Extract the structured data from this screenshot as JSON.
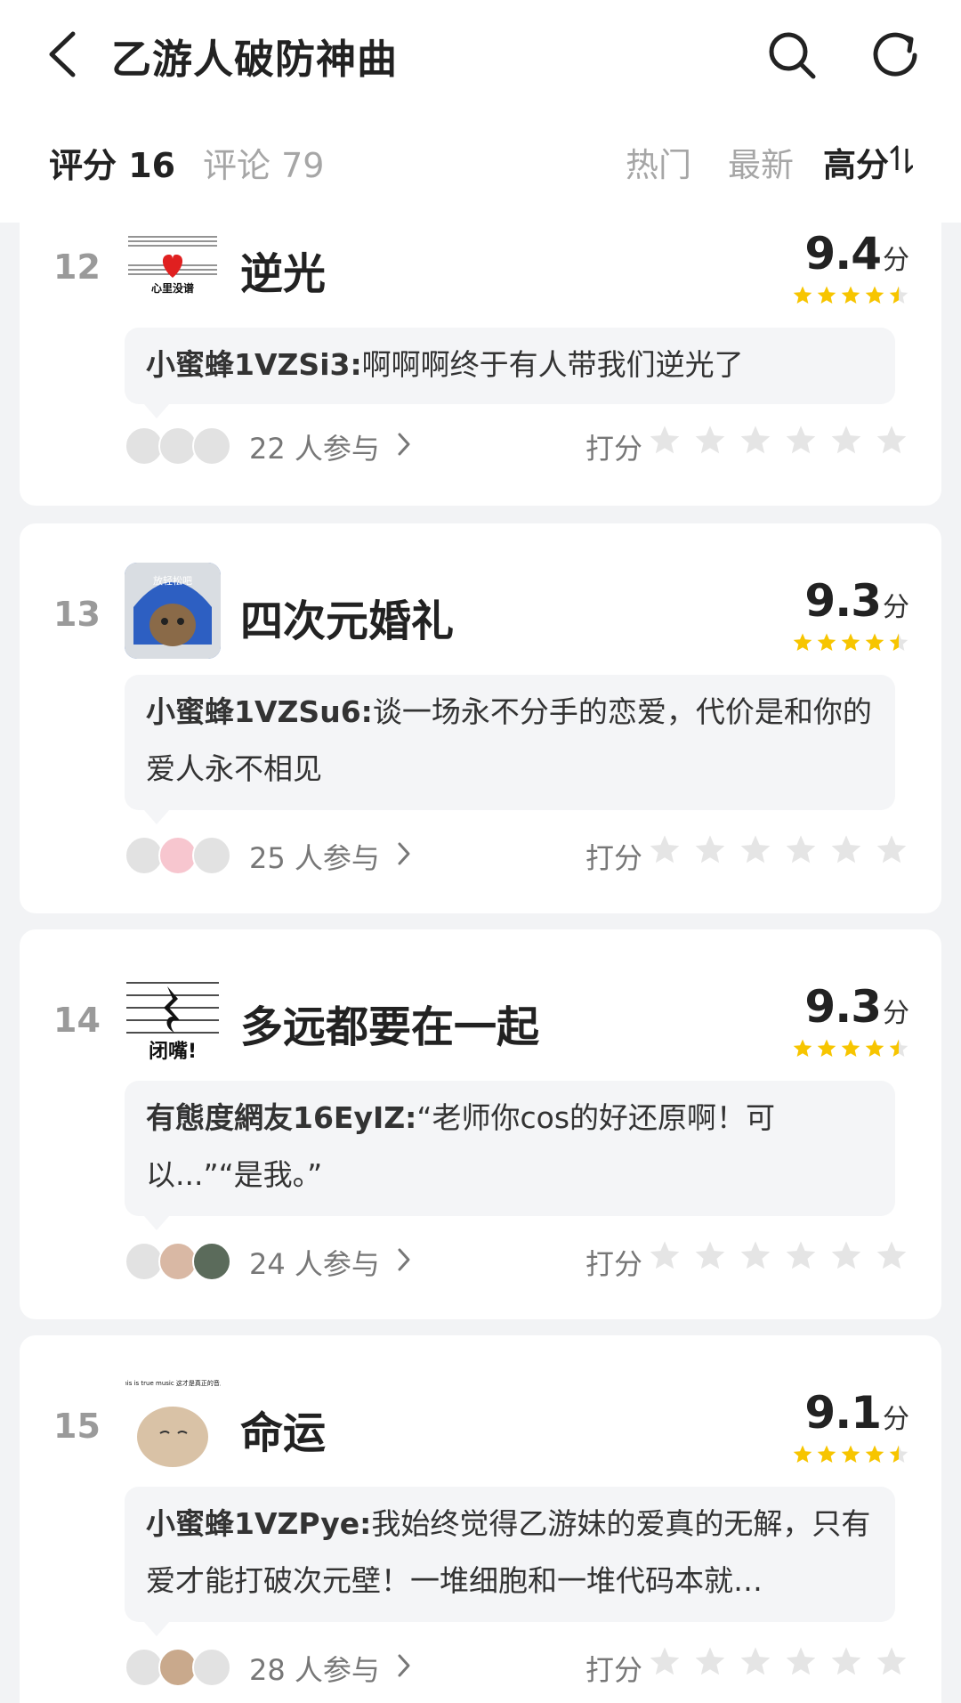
{
  "header": {
    "title": "乙游人破防神曲",
    "back_icon": "chevron-left-icon",
    "search_icon": "search-icon",
    "refresh_icon": "refresh-icon"
  },
  "tabs": {
    "score": "评分 16",
    "comments": "评论 79"
  },
  "sort": {
    "hot": "热门",
    "latest": "最新",
    "high": "高分",
    "high_icon": "sort-arrows-icon"
  },
  "colors": {
    "star_yellow": "#f7c500",
    "star_gray": "#e5e5e5",
    "background": "#f2f3f5"
  },
  "unit": "分",
  "rate_label": "打分",
  "items": [
    {
      "rank": "12",
      "title": "逆光",
      "score": "9.4",
      "rating": 4.5,
      "cover_text": "心里没谱",
      "comment_user": "小蜜蜂1VZSi3:",
      "comment_text": "啊啊啊终于有人带我们逆光了",
      "participants": "22 人参与"
    },
    {
      "rank": "13",
      "title": "四次元婚礼",
      "score": "9.3",
      "rating": 4.5,
      "cover_text": "放轻松吧",
      "comment_user": "小蜜蜂1VZSu6:",
      "comment_text": "谈一场永不分手的恋爱，代价是和你的爱人永不相见",
      "participants": "25 人参与"
    },
    {
      "rank": "14",
      "title": "多远都要在一起",
      "score": "9.3",
      "rating": 4.5,
      "cover_text": "闭嘴!",
      "comment_user": "有態度網友16EyIZ:",
      "comment_text": "“老师你cos的好还原啊！可以...”“是我。”",
      "participants": "24 人参与"
    },
    {
      "rank": "15",
      "title": "命运",
      "score": "9.1",
      "rating": 4.5,
      "cover_text": "This is true music 这才是真正的音乐",
      "comment_user": "小蜜蜂1VZPye:",
      "comment_text": "我始终觉得乙游妹的爱真的无解，只有爱才能打破次元壁！一堆细胞和一堆代码本就…",
      "participants": "28 人参与"
    }
  ]
}
